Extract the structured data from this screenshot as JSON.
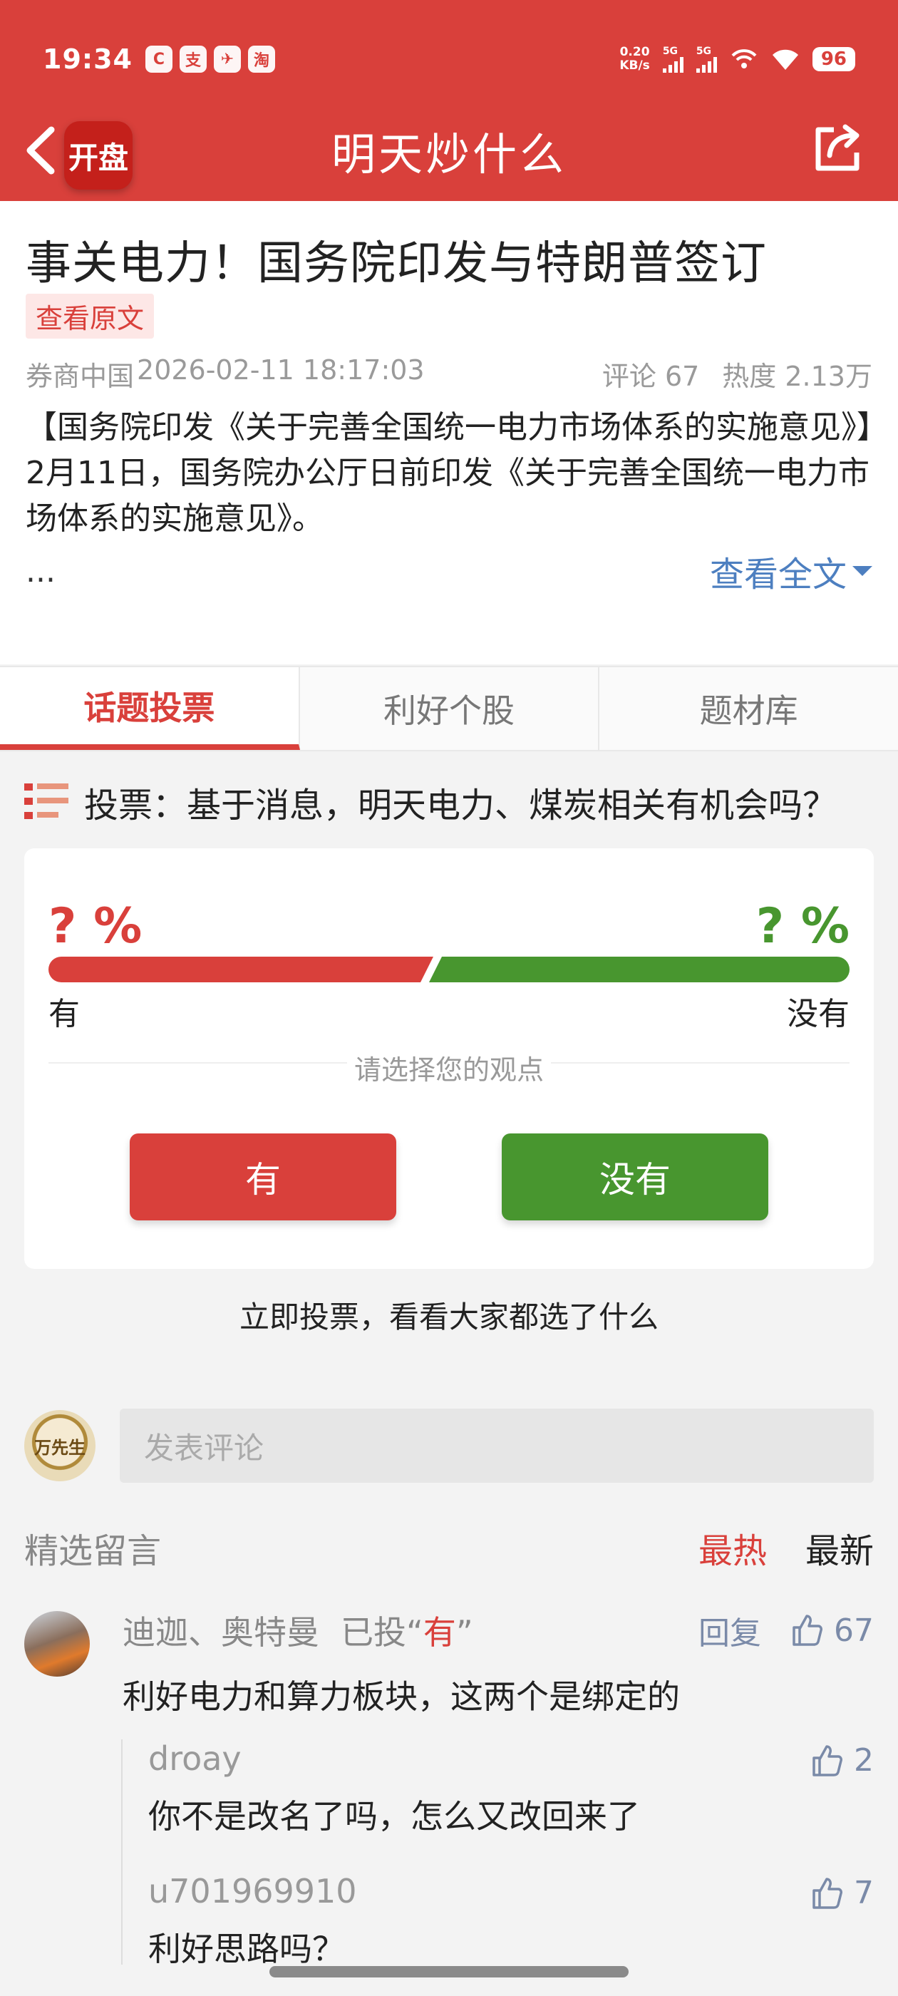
{
  "status_bar": {
    "time": "19:34",
    "net_speed_value": "0.20",
    "net_speed_unit": "KB/s",
    "signal1": "5G",
    "signal2": "5G",
    "battery": "96",
    "apps": [
      "C",
      "支",
      "✈",
      "淘"
    ]
  },
  "nav": {
    "logo_text": "开盘",
    "title": "明天炒什么"
  },
  "article": {
    "title": "事关电力！国务院印发与特朗普签订",
    "view_original": "查看原文",
    "source": "券商中国",
    "datetime": "2026-02-11 18:17:03",
    "comments_label": "评论 67",
    "heat_label": "热度 2.13万",
    "body_line1": "【国务院印发《关于完善全国统一电力市场体系的实施意见》】",
    "body_line2": "2月11日，国务院办公厅日前印发《关于完善全国统一电力市场体系的实施意见》。",
    "ellipsis": "...",
    "see_all": "查看全文"
  },
  "tabs": [
    {
      "label": "话题投票",
      "active": true
    },
    {
      "label": "利好个股",
      "active": false
    },
    {
      "label": "题材库",
      "active": false
    }
  ],
  "vote": {
    "question": "投票：基于消息，明天电力、煤炭相关有机会吗？",
    "yes_pct": "? %",
    "no_pct": "? %",
    "yes_label": "有",
    "no_label": "没有",
    "prompt": "请选择您的观点",
    "yes_button": "有",
    "no_button": "没有",
    "hint": "立即投票，看看大家都选了什么",
    "colors": {
      "yes": "#d9403b",
      "no": "#48962f"
    }
  },
  "comments": {
    "avatar_text": "万先生",
    "input_placeholder": "发表评论",
    "section_title": "精选留言",
    "sort_hot": "最热",
    "sort_new": "最新",
    "items": [
      {
        "user": "迪迦、奥特曼",
        "voted_prefix": "已投“",
        "voted_choice": "有",
        "voted_suffix": "”",
        "reply_label": "回复",
        "likes": "67",
        "text": "利好电力和算力板块，这两个是绑定的"
      }
    ],
    "replies": [
      {
        "user": "droay",
        "likes": "2",
        "text": "你不是改名了吗，怎么又改回来了"
      },
      {
        "user": "u701969910",
        "likes": "7",
        "text": "利好思路吗？"
      }
    ]
  }
}
